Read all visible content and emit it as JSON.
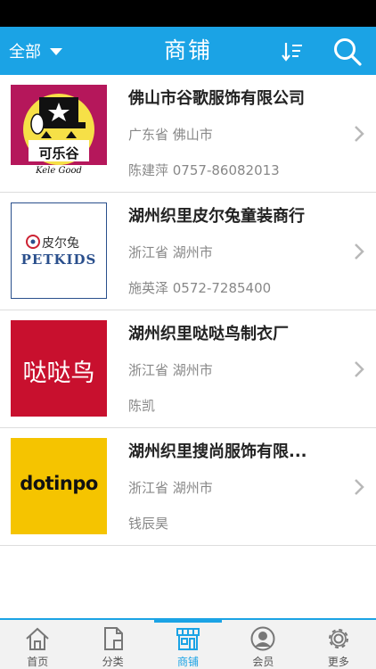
{
  "header": {
    "region_label": "全部",
    "title": "商铺",
    "sort_icon": "sort-icon",
    "search_icon": "search-icon",
    "accent": "#1ba3e5"
  },
  "shops": [
    {
      "name": "佛山市谷歌服饰有限公司",
      "location": "广东省 佛山市",
      "contact": "陈建萍 0757-86082013",
      "logo_text": "可乐谷",
      "logo_subtext": "Kele Good"
    },
    {
      "name": "湖州织里皮尔兔童装商行",
      "location": "浙江省 湖州市",
      "contact": "施英泽 0572-7285400",
      "logo_text": "皮尔兔",
      "logo_subtext": "PETKIDS"
    },
    {
      "name": "湖州织里哒哒鸟制衣厂",
      "location": "浙江省 湖州市",
      "contact": "陈凯",
      "logo_text": "哒哒鸟"
    },
    {
      "name": "湖州织里搜尚服饰有限...",
      "location": "浙江省 湖州市",
      "contact": "钱辰昊",
      "logo_text": "dotinpo"
    }
  ],
  "tabs": [
    {
      "label": "首页",
      "icon": "home-icon",
      "active": false
    },
    {
      "label": "分类",
      "icon": "category-icon",
      "active": false
    },
    {
      "label": "商铺",
      "icon": "shop-icon",
      "active": true
    },
    {
      "label": "会员",
      "icon": "member-icon",
      "active": false
    },
    {
      "label": "更多",
      "icon": "settings-icon",
      "active": false
    }
  ]
}
